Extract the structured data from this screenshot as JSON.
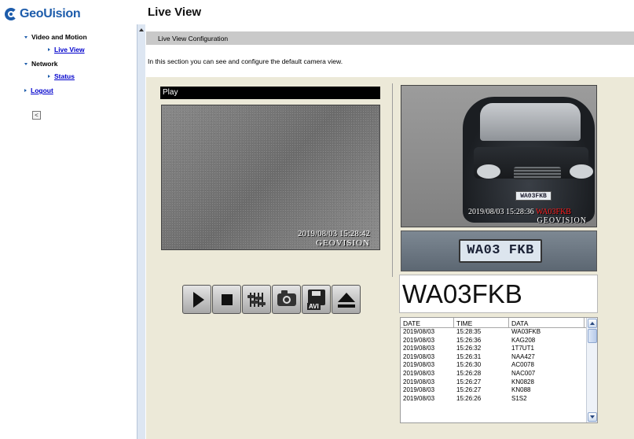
{
  "brand": {
    "logo_text": "GeoUision"
  },
  "nav": {
    "video_motion": "Video and Motion",
    "live_view": "Live View",
    "network": "Network",
    "status": "Status",
    "logout": "Logout",
    "collapse_glyph": "<"
  },
  "page": {
    "title": "Live View",
    "section_title": "Live View Configuration",
    "description": "In this section you can see and configure the default camera view."
  },
  "main_video": {
    "header": "Play",
    "timestamp": "2019/08/03 15:28:42",
    "brand": "GEOVISION"
  },
  "car_video": {
    "plate_small": "WA03FKB",
    "timestamp": "2019/08/03 15:28:36",
    "plate_overlay": "WA03FKB",
    "brand": "GEOVISION"
  },
  "plate_crop": {
    "text": "WA03 FKB"
  },
  "plate_number": "WA03FKB",
  "controls": {
    "play": "play-icon",
    "stop": "stop-icon",
    "settings": "sliders-icon",
    "snapshot": "camera-icon",
    "record_avi": "avi-save-icon",
    "avi_label": "AVI",
    "eject": "eject-icon"
  },
  "log": {
    "columns": [
      "DATE",
      "TIME",
      "DATA"
    ],
    "rows": [
      [
        "2019/08/03",
        "15:28:35",
        "WA03FKB"
      ],
      [
        "2019/08/03",
        "15:26:36",
        "KAG208"
      ],
      [
        "2019/08/03",
        "15:26:32",
        "1T7UT1"
      ],
      [
        "2019/08/03",
        "15:26:31",
        "NAA427"
      ],
      [
        "2019/08/03",
        "15:26:30",
        "AC0078"
      ],
      [
        "2019/08/03",
        "15:26:28",
        "NAC007"
      ],
      [
        "2019/08/03",
        "15:26:27",
        "KN0828"
      ],
      [
        "2019/08/03",
        "15:26:27",
        "KN088"
      ],
      [
        "2019/08/03",
        "15:26:26",
        "S1S2"
      ]
    ]
  },
  "colors": {
    "brand_blue": "#1d5cab",
    "link": "#0000cc",
    "panel": "#ece9d8",
    "overlay_red": "#ff1a1a"
  }
}
